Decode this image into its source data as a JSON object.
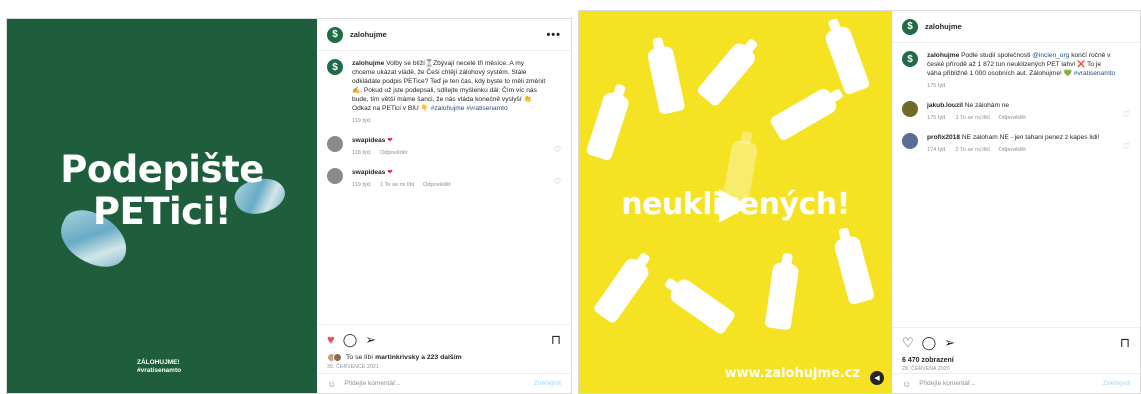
{
  "post1": {
    "username": "zalohujme",
    "more_label": "•••",
    "media": {
      "title_line1": "Podepište",
      "title_line2": "PETici!",
      "footer_line1": "ZÁLOHUJME!",
      "footer_line2": "#vratisenamto",
      "bg_color": "#1f5e3c"
    },
    "caption": {
      "author": "zalohujme",
      "text": "Volby se blíží⏳Zbývají necelé tři měsíce. A my chceme ukázat vládě, že Češi chtějí zálohový systém. Stále odkládáte podpis PETice? Teď je ten čas, kdy byste to měli změnit ✍. Pokud už jste podepsali, sdílejte myšlenku dál. Čím víc nás bude, tím větší máme šanci, že nás vláda konečně vyslyší 👏 Odkaz na PETici v BIU 👇",
      "tags": "#zalohujme #vratisenamto",
      "time": "119 týd."
    },
    "comments": [
      {
        "user": "swapideas",
        "text": "❤",
        "time": "118 týd.",
        "reply": "Odpovědět",
        "likes": ""
      },
      {
        "user": "swapideas",
        "text": "❤",
        "time": "119 týd.",
        "likes": "1 To se mi líbí",
        "reply": "Odpovědět"
      }
    ],
    "liked_by_prefix": "To se líbí",
    "liked_by_user": "martinkrivsky",
    "liked_by_suffix": "a 223 dalším",
    "date": "30. ČERVENCE 2021",
    "add_comment_placeholder": "Přidejte komentář...",
    "post_button": "Zveřejnit"
  },
  "post2": {
    "username": "zalohujme",
    "more_label": "•••",
    "media": {
      "title": "neuklizených!",
      "url": "www.zalohujme.cz",
      "bg_color": "#f5e222"
    },
    "caption": {
      "author": "zalohujme",
      "text": "Podle studií společnosti",
      "mention": "@incien_org",
      "text2": "končí ročně v české přírodě až 1 872 tun neuklizených PET lahví ❌ To je váha přibližně 1 000 osobních aut. Zálohujme! 💚",
      "tags": "#vratisenamto",
      "time": "175 týd."
    },
    "comments": [
      {
        "user": "jakub.louzil",
        "text": "Ne zálohám ne",
        "time": "175 týd.",
        "likes": "1 To se mi líbí",
        "reply": "Odpovědět"
      },
      {
        "user": "profix2018",
        "text": "NE zaloham NE - jen tahani penez z kapes lidi!",
        "time": "174 týd.",
        "likes": "2 To se mi líbí",
        "reply": "Odpovědět"
      }
    ],
    "views": "6 470 zobrazení",
    "date": "28. ČERVENA 2020",
    "add_comment_placeholder": "Přidejte komentář...",
    "post_button": "Zveřejnit"
  },
  "icons": {
    "heart": "heart-icon",
    "comment": "comment-icon",
    "share": "share-icon",
    "bookmark": "bookmark-icon",
    "emoji": "emoji-icon",
    "play": "play-icon",
    "mute": "mute-icon"
  }
}
